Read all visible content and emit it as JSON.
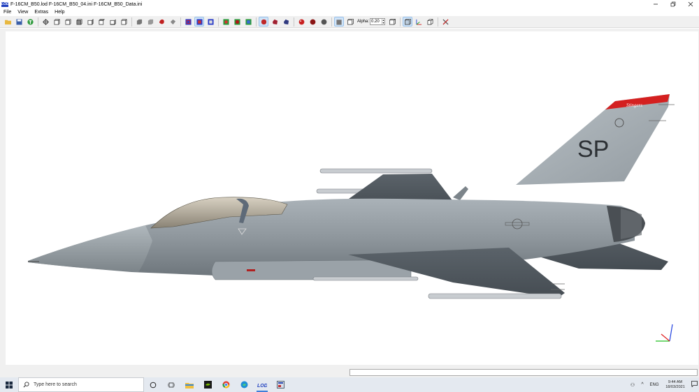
{
  "window": {
    "app_icon_text": "LOD",
    "title": "F-16CM_B50.lod  F-16CM_B50_04.ini  F-16CM_B50_Data.ini",
    "controls": [
      "minimize",
      "restore",
      "close"
    ]
  },
  "menu": {
    "items": [
      "File",
      "View",
      "Extras",
      "Help"
    ]
  },
  "toolbar": {
    "alpha_label": "Alpha:",
    "alpha_value": "0.20"
  },
  "model": {
    "tail_code": "SP",
    "tail_band_text": "Stingers"
  },
  "taskbar": {
    "search_placeholder": "Type here to search",
    "language": "ENG",
    "time": "9:44 AM",
    "date": "18/03/2021"
  },
  "colors": {
    "accent": "#3f7fd9",
    "tail_band": "#d42020",
    "airframe": "#8d959b"
  }
}
